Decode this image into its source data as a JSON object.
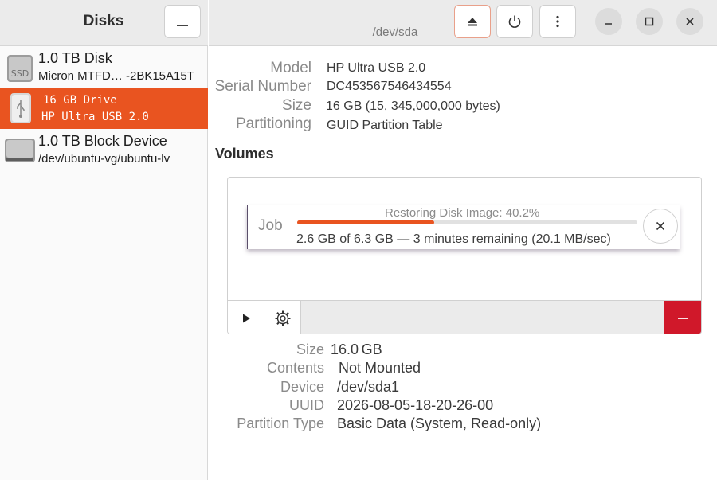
{
  "sidebar": {
    "title": "Disks",
    "disks": [
      {
        "name": "1.0 TB Disk",
        "sub": "Micron MTFD… -2BK15A15T",
        "icon": "ssd-icon",
        "icon_text": "SSD",
        "selected": false
      },
      {
        "name": "16 GB Drive",
        "sub": "HP Ultra USB 2.0",
        "icon": "usb-drive-icon",
        "selected": true
      },
      {
        "name": "1.0 TB Block Device",
        "sub": "/dev/ubuntu-vg/ubuntu-lv",
        "icon": "hard-drive-icon",
        "selected": false
      }
    ]
  },
  "header": {
    "subtitle": "/dev/sda"
  },
  "drive": {
    "model_label": "Model",
    "model": "HP Ultra USB 2.0",
    "serial_label": "Serial Number",
    "serial": "DC453567546434554",
    "size_label": "Size",
    "size": "16 GB (15, 345,000,000 bytes)",
    "partitioning_label": "Partitioning",
    "partitioning": "GUID Partition Table"
  },
  "volumes": {
    "heading": "Volumes"
  },
  "job": {
    "label": "Job",
    "title": "Restoring Disk Image: 40.2%",
    "progress": 0.402,
    "detail": "2.6 GB of 6.3 GB — 3 minutes remaining (20.1 MB/sec)"
  },
  "partition": {
    "size_label": "Size",
    "size": "16.0 GB",
    "contents_label": "Contents",
    "contents": "Not Mounted",
    "device_label": "Device",
    "device": "/dev/sda1",
    "uuid_label": "UUID",
    "uuid": "2026-08-05-18-20-26-00",
    "type_label": "Partition Type",
    "type": "Basic Data (System, Read-only)"
  },
  "colors": {
    "accent": "#e95420",
    "destructive": "#d0182a"
  }
}
